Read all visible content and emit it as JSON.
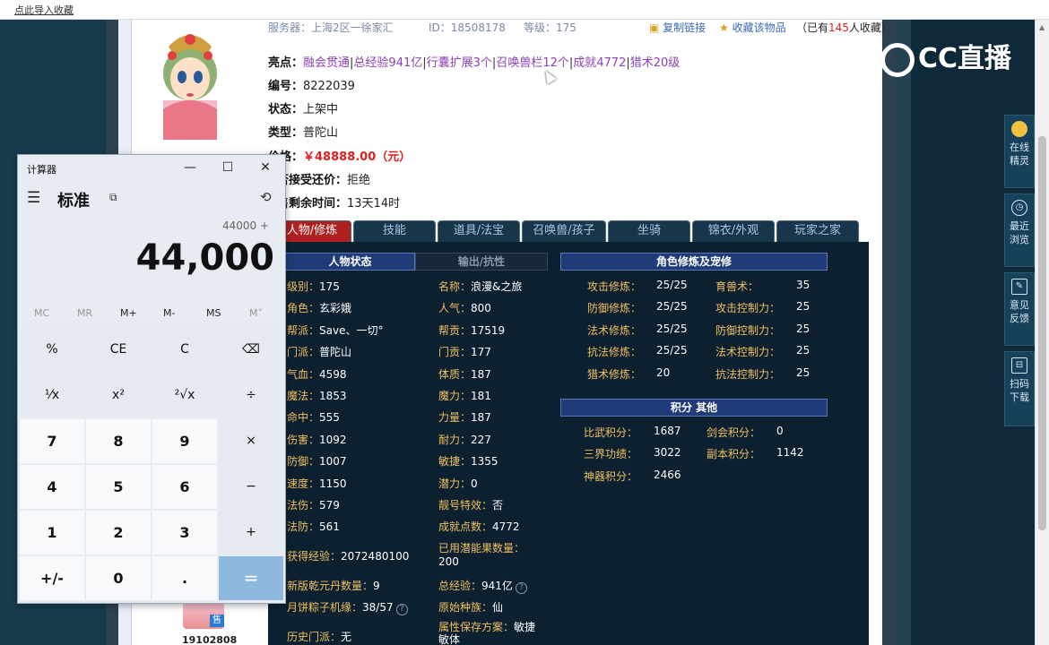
{
  "browser": {
    "bookmark_label": "点此导入收藏"
  },
  "listing": {
    "server": "服务器：上海2区一徐家汇",
    "id_text": "ID：18508178",
    "level_text": "等级：175",
    "copy_link": "复制链接",
    "favorite": "收藏该物品",
    "fav_prefix": "（已有",
    "fav_count": "145",
    "fav_suffix": "人收藏）",
    "highlights_label": "亮点：",
    "highlights": [
      "融会贯通",
      "总经验941亿",
      "行囊扩展3个",
      "召唤兽栏12个",
      "成就4772",
      "猎术20级"
    ],
    "number_label": "编号：",
    "number": "8222039",
    "status_label": "状态：",
    "status": "上架中",
    "type_label": "类型：",
    "type": "普陀山",
    "price_label": "价格：",
    "price": "￥48888.00（元）",
    "bargain_label": "否接受还价：",
    "bargain": "拒绝",
    "remain_label": "售剩余时间：",
    "remain": "13天14时",
    "seller_id": "19102808",
    "seller_badge": "售"
  },
  "tabs": [
    "人物/修炼",
    "技能",
    "道具/法宝",
    "召唤兽/孩子",
    "坐骑",
    "锦衣/外观",
    "玩家之家"
  ],
  "board": {
    "head_char": "人物状态",
    "head_output": "输出/抗性",
    "head_cultivation": "角色修炼及宠修",
    "head_points": "积分 其他",
    "col1": [
      {
        "k": "级别：",
        "v": "175"
      },
      {
        "k": "角色：",
        "v": "玄彩娥"
      },
      {
        "k": "帮派：",
        "v": "Save、一切°"
      },
      {
        "k": "门派：",
        "v": "普陀山"
      },
      {
        "k": "气血：",
        "v": "4598"
      },
      {
        "k": "魔法：",
        "v": "1853"
      },
      {
        "k": "命中：",
        "v": "555"
      },
      {
        "k": "伤害：",
        "v": "1092"
      },
      {
        "k": "防御：",
        "v": "1007"
      },
      {
        "k": "速度：",
        "v": "1150"
      },
      {
        "k": "法伤：",
        "v": "579"
      },
      {
        "k": "法防：",
        "v": "561"
      }
    ],
    "col2": [
      {
        "k": "名称：",
        "v": "浪漫&之旅"
      },
      {
        "k": "人气：",
        "v": "800"
      },
      {
        "k": "帮贡：",
        "v": "17519"
      },
      {
        "k": "门贡：",
        "v": "177"
      },
      {
        "k": "体质：",
        "v": "187"
      },
      {
        "k": "魔力：",
        "v": "181"
      },
      {
        "k": "力量：",
        "v": "187"
      },
      {
        "k": "耐力：",
        "v": "227"
      },
      {
        "k": "敏捷：",
        "v": "1355"
      },
      {
        "k": "潜力：",
        "v": "0"
      },
      {
        "k": "靓号特效：",
        "v": "否"
      },
      {
        "k": "成就点数：",
        "v": "4772"
      }
    ],
    "extra": {
      "exp_label": "获得经验：",
      "exp": "2072480100",
      "used_label": "已用潜能果数量：",
      "used": "200",
      "qiankun_label": "新版乾元丹数量：",
      "qiankun": "9",
      "total_exp_label": "总经验：",
      "total_exp": "941亿",
      "zongzi_label": "月饼粽子机缘：",
      "zongzi": "38/57",
      "race_label": "原始种族：",
      "race": "仙",
      "history_label": "历史门派：",
      "history": "无",
      "save_label": "属性保存方案：",
      "save": "敏捷 敏体"
    },
    "cultivation": [
      {
        "k": "攻击修炼：",
        "v": "25/25",
        "k2": "育兽术：",
        "v2": "35"
      },
      {
        "k": "防御修炼：",
        "v": "25/25",
        "k2": "攻击控制力：",
        "v2": "25"
      },
      {
        "k": "法术修炼：",
        "v": "25/25",
        "k2": "防御控制力：",
        "v2": "25"
      },
      {
        "k": "抗法修炼：",
        "v": "25/25",
        "k2": "法术控制力：",
        "v2": "25"
      },
      {
        "k": "猎术修炼：",
        "v": "20",
        "k2": "抗法控制力：",
        "v2": "25"
      }
    ],
    "points": [
      {
        "k": "比武积分：",
        "v": "1687",
        "k2": "剑会积分：",
        "v2": "0"
      },
      {
        "k": "三界功绩：",
        "v": "3022",
        "k2": "副本积分：",
        "v2": "1142"
      },
      {
        "k": "神器积分：",
        "v": "2466",
        "k2": "",
        "v2": ""
      }
    ]
  },
  "logo": {
    "text": "CC直播"
  },
  "side": [
    {
      "label1": "在线",
      "label2": "精灵"
    },
    {
      "label1": "最近",
      "label2": "浏览"
    },
    {
      "label1": "意见",
      "label2": "反馈"
    },
    {
      "label1": "扫码",
      "label2": "下载"
    }
  ],
  "calculator": {
    "title": "计算器",
    "mode": "标准",
    "expression": "44000 +",
    "display": "44,000",
    "memory": [
      "MC",
      "MR",
      "M+",
      "M-",
      "MS",
      "M˅"
    ],
    "keys": [
      [
        "%",
        "CE",
        "C",
        "⌫"
      ],
      [
        "¹⁄x",
        "x²",
        "²√x",
        "÷"
      ],
      [
        "7",
        "8",
        "9",
        "×"
      ],
      [
        "4",
        "5",
        "6",
        "−"
      ],
      [
        "1",
        "2",
        "3",
        "+"
      ],
      [
        "+/-",
        "0",
        ".",
        "="
      ]
    ]
  }
}
